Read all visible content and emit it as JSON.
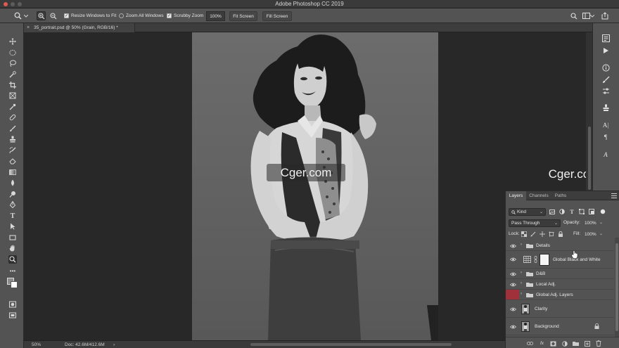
{
  "window": {
    "title": "Adobe Photoshop CC 2019"
  },
  "options_bar": {
    "resize_windows": "Resize Windows to Fit",
    "zoom_all": "Zoom All Windows",
    "scrubby_zoom": "Scrubby Zoom",
    "zoom_value": "100%",
    "fit_screen": "Fit Screen",
    "fill_screen": "Fill Screen"
  },
  "document": {
    "tab_title": "35_portrait.psd @ 50% (Grain, RGB/16) *"
  },
  "status_bar": {
    "zoom": "50%",
    "doc_info": "Doc: 42.6M/412.6M"
  },
  "watermark": {
    "text": "Cger.com"
  },
  "layers_panel": {
    "tabs": [
      "Layers",
      "Channels",
      "Paths"
    ],
    "filter_kind": "Kind",
    "blend_mode": "Pass Through",
    "opacity_label": "Opacity:",
    "opacity_value": "100%",
    "lock_label": "Lock:",
    "fill_label": "Fill:",
    "fill_value": "100%",
    "layers": [
      {
        "name": "Details"
      },
      {
        "name": "Global Black and White"
      },
      {
        "name": "D&B"
      },
      {
        "name": "Local Adj."
      },
      {
        "name": "Global Adj. Layers"
      },
      {
        "name": "Clarity"
      },
      {
        "name": "Background"
      }
    ],
    "footer_fx": "fx"
  },
  "colors": {
    "accent_red": "#a0313a",
    "panel_bg": "#535353",
    "canvas_bg": "#282828"
  },
  "icons": [
    "zoom-icon",
    "zoom-in-icon",
    "zoom-out-icon",
    "search-icon",
    "workspace-icon",
    "share-icon",
    "eye-icon",
    "folder-icon",
    "lock-icon"
  ]
}
